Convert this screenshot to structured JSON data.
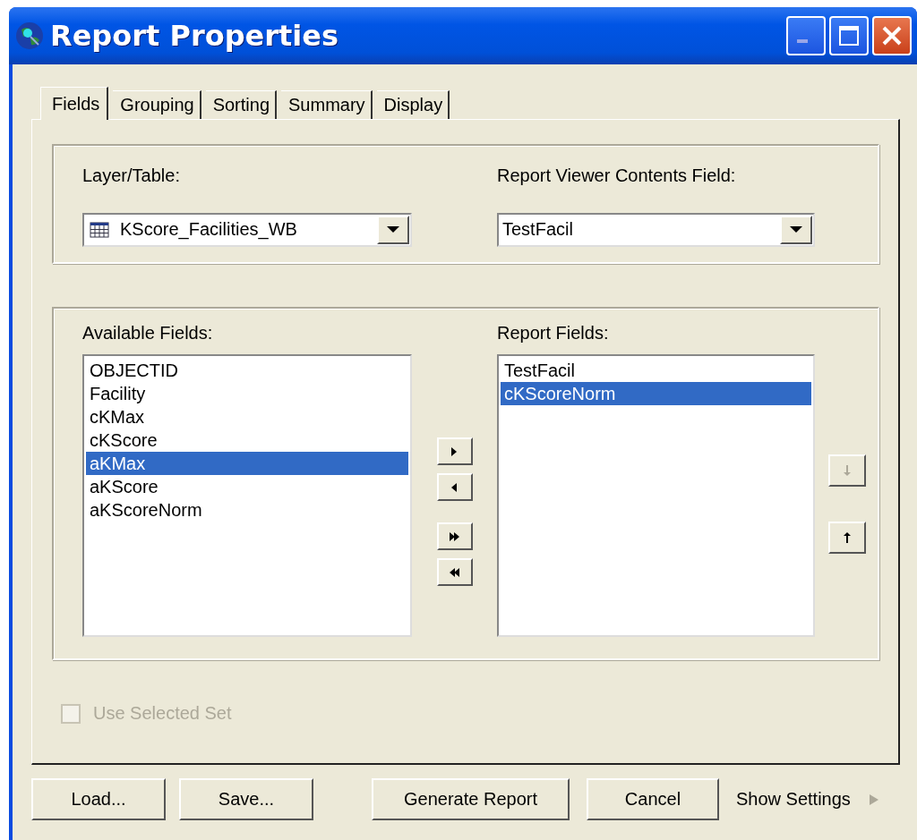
{
  "window": {
    "title": "Report Properties"
  },
  "tabs": [
    {
      "label": "Fields",
      "selected": true
    },
    {
      "label": "Grouping",
      "selected": false
    },
    {
      "label": "Sorting",
      "selected": false
    },
    {
      "label": "Summary",
      "selected": false
    },
    {
      "label": "Display",
      "selected": false
    }
  ],
  "layer_table": {
    "label": "Layer/Table:",
    "value": "KScore_Facilities_WB"
  },
  "contents_field": {
    "label": "Report Viewer Contents Field:",
    "value": "TestFacil"
  },
  "available_fields": {
    "label": "Available Fields:",
    "items": [
      {
        "text": "OBJECTID",
        "selected": false
      },
      {
        "text": "Facility",
        "selected": false
      },
      {
        "text": "cKMax",
        "selected": false
      },
      {
        "text": "cKScore",
        "selected": false
      },
      {
        "text": "aKMax",
        "selected": true
      },
      {
        "text": "aKScore",
        "selected": false
      },
      {
        "text": "aKScoreNorm",
        "selected": false
      }
    ]
  },
  "report_fields": {
    "label": "Report Fields:",
    "items": [
      {
        "text": "TestFacil",
        "selected": false
      },
      {
        "text": "cKScoreNorm",
        "selected": true
      }
    ]
  },
  "move_buttons": [
    {
      "kind": "add",
      "disabled": false
    },
    {
      "kind": "remove",
      "disabled": false
    },
    {
      "kind": "add-all",
      "disabled": false
    },
    {
      "kind": "remove-all",
      "disabled": false
    }
  ],
  "order_buttons": [
    {
      "kind": "down",
      "disabled": true
    },
    {
      "kind": "up",
      "disabled": false
    }
  ],
  "use_selected_set": {
    "label": "Use Selected Set",
    "checked": false,
    "disabled": true
  },
  "buttons": [
    {
      "label": "Load..."
    },
    {
      "label": "Save..."
    },
    {
      "label": "Generate Report"
    },
    {
      "label": "Cancel"
    }
  ],
  "show_settings": {
    "label": "Show Settings"
  }
}
